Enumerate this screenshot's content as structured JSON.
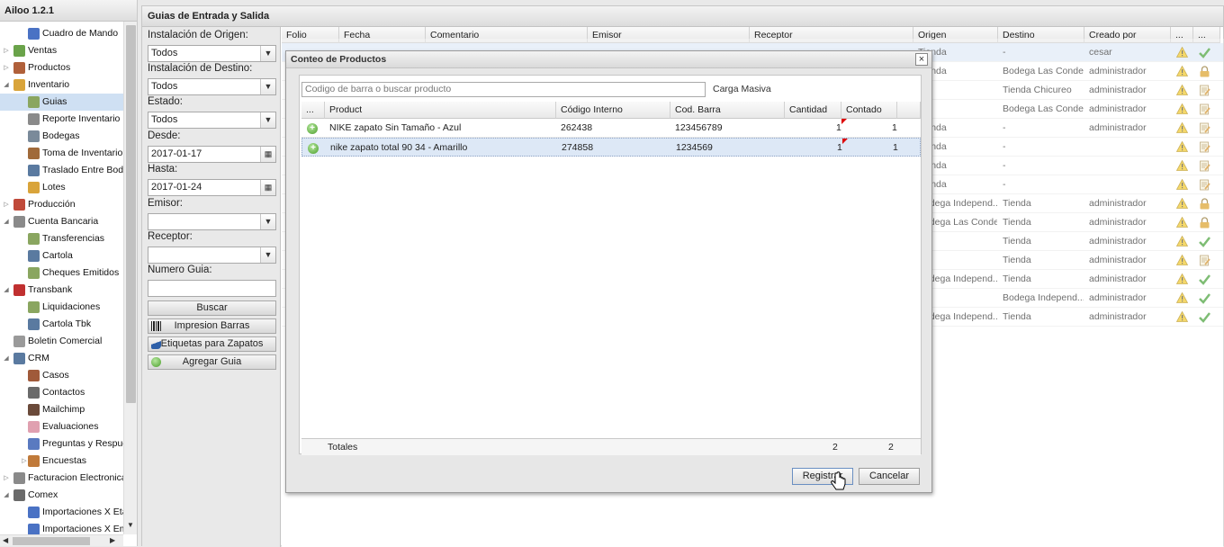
{
  "app": {
    "title": "Ailoo 1.2.1"
  },
  "sidebar": {
    "items": [
      {
        "label": "Cuadro de Mando",
        "level": 1,
        "arrow": "",
        "icon": "chart-icon",
        "color": "#4a72c4"
      },
      {
        "label": "Ventas",
        "level": 0,
        "arrow": "▷",
        "icon": "tag-icon",
        "color": "#6aa34a"
      },
      {
        "label": "Productos",
        "level": 0,
        "arrow": "▷",
        "icon": "box-icon",
        "color": "#b0603a"
      },
      {
        "label": "Inventario",
        "level": 0,
        "arrow": "◢",
        "icon": "package-icon",
        "color": "#d9a43a"
      },
      {
        "label": "Guias",
        "level": 1,
        "arrow": "",
        "icon": "document-icon",
        "color": "#8aa660",
        "selected": true
      },
      {
        "label": "Reporte Inventario",
        "level": 1,
        "arrow": "",
        "icon": "report-icon",
        "color": "#8a8a8a"
      },
      {
        "label": "Bodegas",
        "level": 1,
        "arrow": "",
        "icon": "building-icon",
        "color": "#7a8a9a"
      },
      {
        "label": "Toma de Inventario",
        "level": 1,
        "arrow": "",
        "icon": "clipboard-icon",
        "color": "#a06a3a"
      },
      {
        "label": "Traslado Entre Bodegas",
        "level": 1,
        "arrow": "",
        "icon": "truck-icon",
        "color": "#5a7aa0"
      },
      {
        "label": "Lotes",
        "level": 1,
        "arrow": "",
        "icon": "boxes-icon",
        "color": "#d9a43a"
      },
      {
        "label": "Producción",
        "level": 0,
        "arrow": "▷",
        "icon": "factory-icon",
        "color": "#c04a3a"
      },
      {
        "label": "Cuenta Bancaria",
        "level": 0,
        "arrow": "◢",
        "icon": "bank-icon",
        "color": "#8a8a8a"
      },
      {
        "label": "Transferencias",
        "level": 1,
        "arrow": "",
        "icon": "transfer-icon",
        "color": "#8aa660"
      },
      {
        "label": "Cartola",
        "level": 1,
        "arrow": "",
        "icon": "table-icon",
        "color": "#5a7aa0"
      },
      {
        "label": "Cheques Emitidos",
        "level": 1,
        "arrow": "",
        "icon": "check-icon",
        "color": "#8aa660"
      },
      {
        "label": "Transbank",
        "level": 0,
        "arrow": "◢",
        "icon": "transbank-icon",
        "color": "#c03030"
      },
      {
        "label": "Liquidaciones",
        "level": 1,
        "arrow": "",
        "icon": "document-icon",
        "color": "#8aa660"
      },
      {
        "label": "Cartola Tbk",
        "level": 1,
        "arrow": "",
        "icon": "table-icon",
        "color": "#5a7aa0"
      },
      {
        "label": "Boletin Comercial",
        "level": 0,
        "arrow": "",
        "icon": "tag-icon",
        "color": "#9a9a9a"
      },
      {
        "label": "CRM",
        "level": 0,
        "arrow": "◢",
        "icon": "users-icon",
        "color": "#5a7aa0"
      },
      {
        "label": "Casos",
        "level": 1,
        "arrow": "",
        "icon": "briefcase-icon",
        "color": "#a05a3a"
      },
      {
        "label": "Contactos",
        "level": 1,
        "arrow": "",
        "icon": "contacts-icon",
        "color": "#6a6a6a"
      },
      {
        "label": "Mailchimp",
        "level": 1,
        "arrow": "",
        "icon": "mailchimp-icon",
        "color": "#6a4a3a"
      },
      {
        "label": "Evaluaciones",
        "level": 1,
        "arrow": "",
        "icon": "heart-icon",
        "color": "#e0a0b0"
      },
      {
        "label": "Preguntas y Respuestas",
        "level": 1,
        "arrow": "",
        "icon": "question-icon",
        "color": "#5a7ac0"
      },
      {
        "label": "Encuestas",
        "level": 1,
        "arrow": "▷",
        "icon": "survey-icon",
        "color": "#c07a3a"
      },
      {
        "label": "Facturacion Electronica",
        "level": 0,
        "arrow": "▷",
        "icon": "invoice-icon",
        "color": "#8a8a8a"
      },
      {
        "label": "Comex",
        "level": 0,
        "arrow": "◢",
        "icon": "ship-icon",
        "color": "#6a6a6a"
      },
      {
        "label": "Importaciones X Etapa",
        "level": 1,
        "arrow": "",
        "icon": "chart-icon",
        "color": "#4a72c4"
      },
      {
        "label": "Importaciones X Embarque",
        "level": 1,
        "arrow": "",
        "icon": "chart-icon",
        "color": "#4a72c4"
      }
    ]
  },
  "panel": {
    "title": "Guias de Entrada y Salida"
  },
  "filters": {
    "origen_label": "Instalación de Origen:",
    "origen_value": "Todos",
    "destino_label": "Instalación de Destino:",
    "destino_value": "Todos",
    "estado_label": "Estado:",
    "estado_value": "Todos",
    "desde_label": "Desde:",
    "desde_value": "2017-01-17",
    "hasta_label": "Hasta:",
    "hasta_value": "2017-01-24",
    "emisor_label": "Emisor:",
    "emisor_value": "",
    "receptor_label": "Receptor:",
    "receptor_value": "",
    "numero_label": "Numero Guia:",
    "numero_value": "",
    "buscar": "Buscar",
    "impresion": "Impresion Barras",
    "etiquetas": "Etiquetas para Zapatos",
    "agregar": "Agregar Guia"
  },
  "grid": {
    "columns": [
      "Folio",
      "Fecha",
      "Comentario",
      "Emisor",
      "Receptor",
      "Origen",
      "Destino",
      "Creado por",
      "...",
      "..."
    ],
    "rows": [
      {
        "origen": "Tienda",
        "destino": "-",
        "creado": "cesar",
        "status": "check"
      },
      {
        "origen": "Tienda",
        "destino": "Bodega Las Condes",
        "creado": "administrador",
        "status": "lock"
      },
      {
        "origen": "",
        "destino": "Tienda Chicureo",
        "creado": "administrador",
        "status": "edit"
      },
      {
        "origen": "",
        "destino": "Bodega Las Condes",
        "creado": "administrador",
        "status": "edit"
      },
      {
        "origen": "Tienda",
        "destino": "-",
        "creado": "administrador",
        "status": "edit"
      },
      {
        "origen": "Tienda",
        "destino": "-",
        "creado": "",
        "status": "edit"
      },
      {
        "origen": "Tienda",
        "destino": "-",
        "creado": "",
        "status": "edit"
      },
      {
        "origen": "Tienda",
        "destino": "-",
        "creado": "",
        "status": "edit"
      },
      {
        "origen": "Bodega Independ...",
        "destino": "Tienda",
        "creado": "administrador",
        "status": "lock"
      },
      {
        "origen": "Bodega Las Condes",
        "destino": "Tienda",
        "creado": "administrador",
        "status": "lock"
      },
      {
        "origen": "",
        "destino": "Tienda",
        "creado": "administrador",
        "status": "check"
      },
      {
        "origen": "",
        "destino": "Tienda",
        "creado": "administrador",
        "status": "edit"
      },
      {
        "origen": "Bodega Independ...",
        "destino": "Tienda",
        "creado": "administrador",
        "status": "check"
      },
      {
        "origen": "",
        "destino": "Bodega Independ...",
        "creado": "administrador",
        "status": "check"
      },
      {
        "origen": "Bodega Independ...",
        "destino": "Tienda",
        "creado": "administrador",
        "status": "check"
      }
    ]
  },
  "dialog": {
    "title": "Conteo de Productos",
    "close": "×",
    "search_placeholder": "Codigo de barra o buscar producto",
    "carga_masiva": "Carga Masiva",
    "columns": [
      "...",
      "Product",
      "Código Interno",
      "Cod. Barra",
      "Cantidad",
      "Contado"
    ],
    "rows": [
      {
        "product": "NIKE zapato Sin Tamaño - Azul",
        "codigo": "262438",
        "barra": "123456789",
        "cantidad": "1",
        "contado": "1"
      },
      {
        "product": "nike zapato total 90 34 - Amarillo",
        "codigo": "274858",
        "barra": "1234569",
        "cantidad": "1",
        "contado": "1"
      }
    ],
    "totales_label": "Totales",
    "total_cantidad": "2",
    "total_contado": "2",
    "registrar": "Registrar",
    "cancelar": "Cancelar"
  },
  "colors": {
    "selection": "#cfe0f3",
    "warning": "#f0c419",
    "check": "#3a9a2a",
    "lock": "#d99a1a"
  }
}
